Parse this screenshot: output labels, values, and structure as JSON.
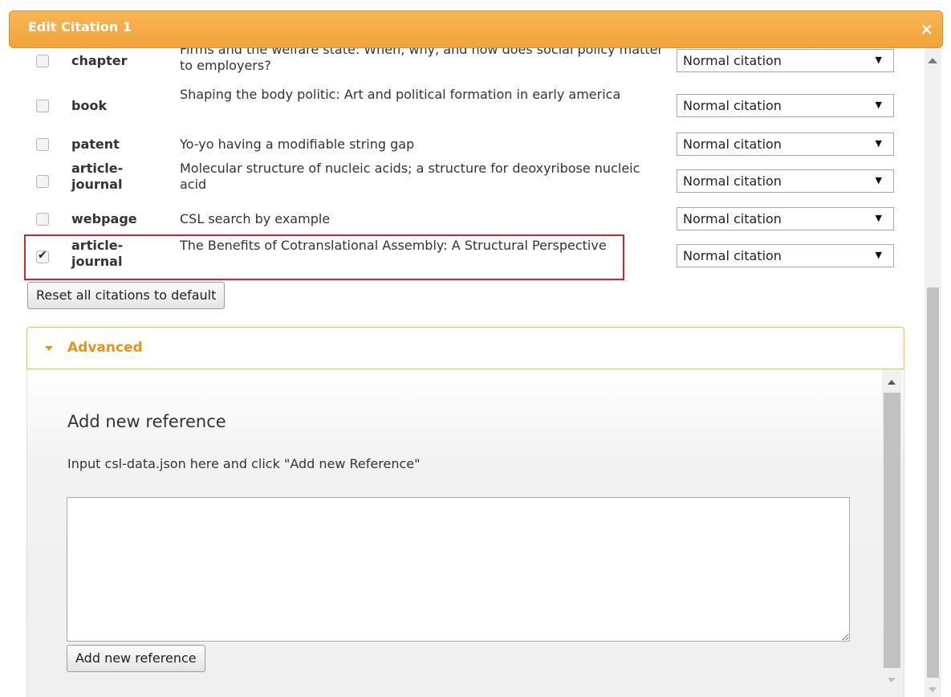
{
  "dialog": {
    "title": "Edit Citation 1",
    "close_glyph": "×"
  },
  "citations": [
    {
      "checked": false,
      "type": "chapter",
      "title": "Firms and the welfare state: When, why, and how does social policy matter to employers?",
      "mode": "Normal citation"
    },
    {
      "checked": false,
      "type": "book",
      "title": "Shaping the body politic: Art and political formation in early america",
      "mode": "Normal citation"
    },
    {
      "checked": false,
      "type": "patent",
      "title": "Yo-yo having a modifiable string gap",
      "mode": "Normal citation"
    },
    {
      "checked": false,
      "type": "article-journal",
      "title": "Molecular structure of nucleic acids; a structure for deoxyribose nucleic acid",
      "mode": "Normal citation"
    },
    {
      "checked": false,
      "type": "webpage",
      "title": "CSL search by example",
      "mode": "Normal citation"
    },
    {
      "checked": true,
      "type": "article-journal",
      "title": "The Benefits of Cotranslational Assembly: A Structural Perspective",
      "mode": "Normal citation"
    }
  ],
  "check_glyph": "✔",
  "dropdown_glyph": "▼",
  "reset_button": "Reset all citations to default",
  "advanced": {
    "label": "Advanced",
    "section_title": "Add new reference",
    "description": "Input csl-data.json here and click \"Add new Reference\"",
    "input_value": "",
    "add_button": "Add new reference"
  },
  "colors": {
    "title_bar": "#f2a33a",
    "advanced_label": "#e8911c",
    "highlight_border": "#d6222d"
  }
}
